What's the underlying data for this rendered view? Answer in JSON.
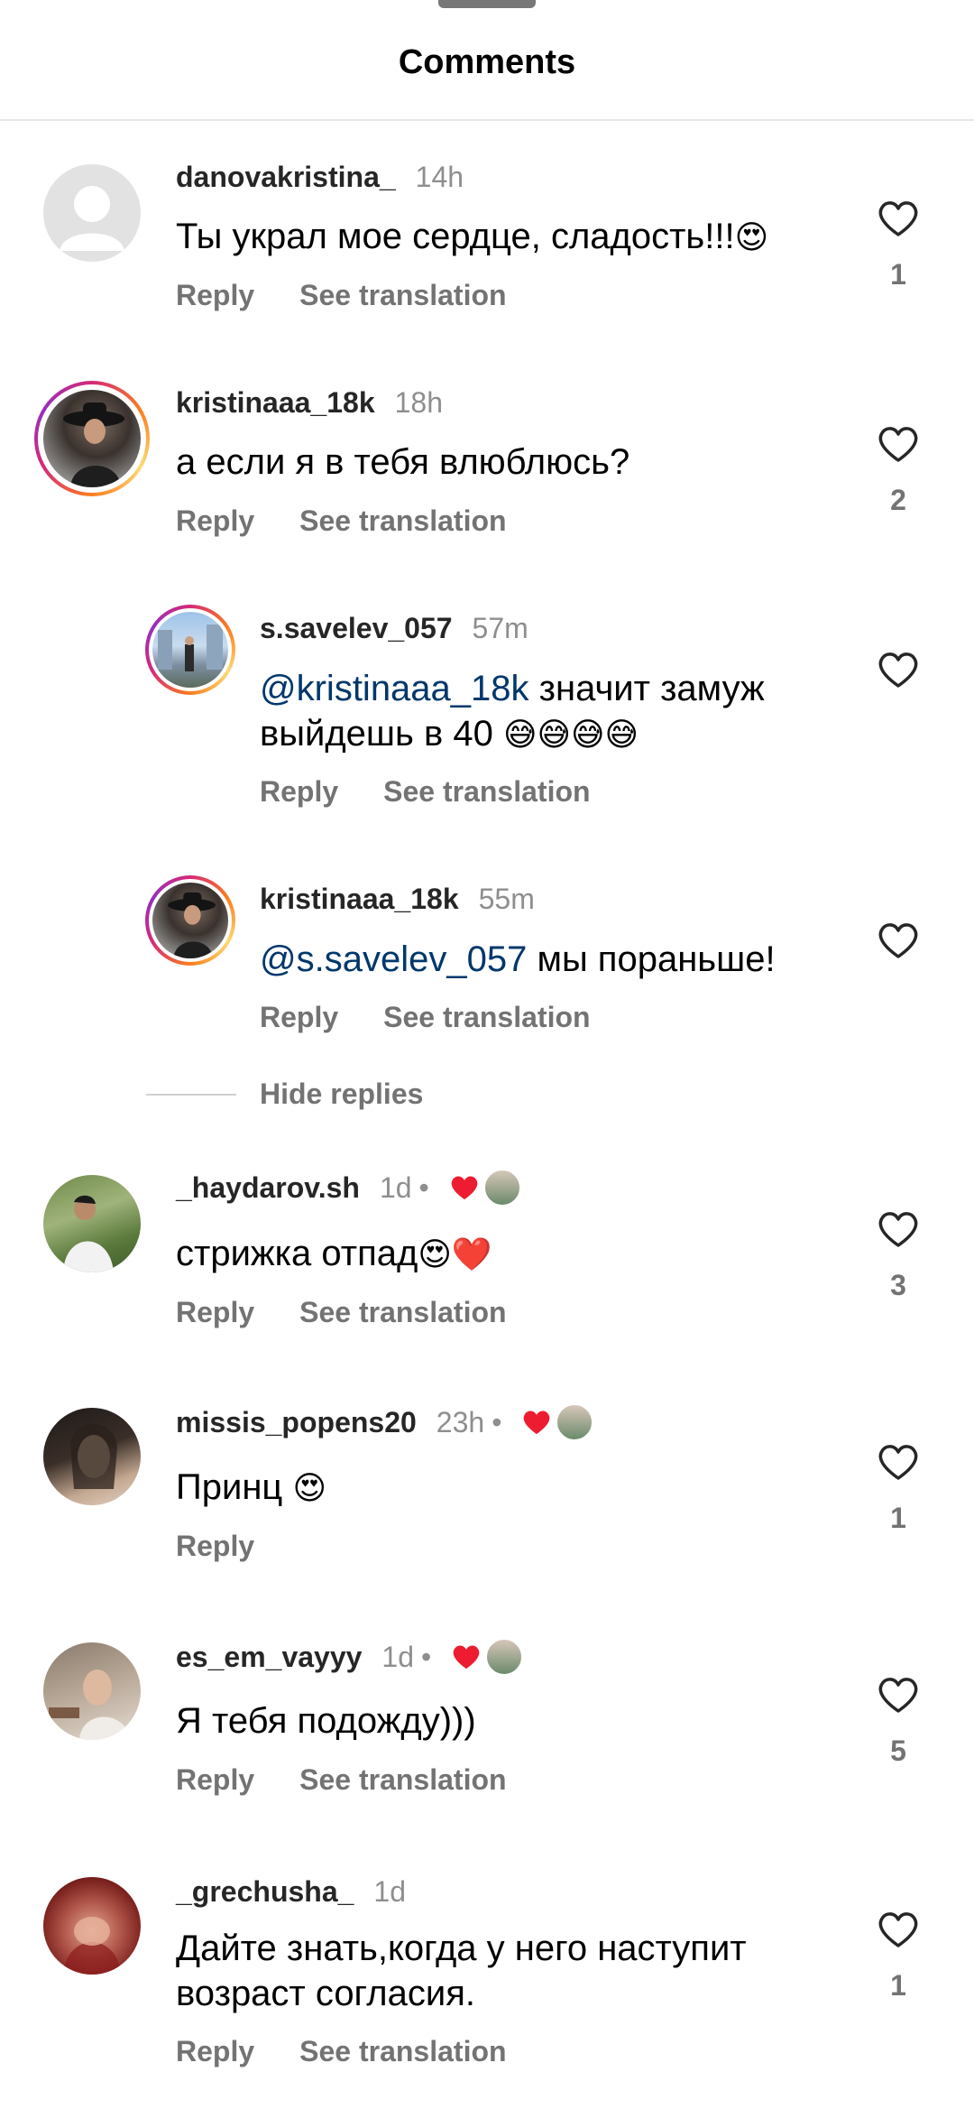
{
  "header": {
    "title": "Comments"
  },
  "labels": {
    "reply": "Reply",
    "see_translation": "See translation",
    "hide_replies": "Hide replies"
  },
  "comments": [
    {
      "username": "danovakristina_",
      "time": "14h",
      "text": "Ты украл мое сердце, сладость!!!",
      "emoji": "😍",
      "likes": "1"
    },
    {
      "username": "kristinaaa_18k",
      "time": "18h",
      "text": "а если я в тебя влюблюсь?",
      "likes": "2"
    },
    {
      "username": "s.savelev_057",
      "time": "57m",
      "mention": "@kristinaaa_18k",
      "text": " значит замуж",
      "text2": "выйдешь в 40 ",
      "emoji": "😅😅😅😅"
    },
    {
      "username": "kristinaaa_18k",
      "time": "55m",
      "mention": "@s.savelev_057",
      "text": " мы пораньше!"
    },
    {
      "username": "_haydarov.sh",
      "time": "1d",
      "text": "стрижка отпад",
      "emoji": "😍❤️",
      "likes": "3"
    },
    {
      "username": "missis_popens20",
      "time": "23h",
      "text": "Принц ",
      "emoji": "😍",
      "likes": "1"
    },
    {
      "username": "es_em_vayyy",
      "time": "1d",
      "text": "Я тебя подожду)))",
      "likes": "5"
    },
    {
      "username": "_grechusha_",
      "time": "1d",
      "text": "Дайте знать,когда у него наступит",
      "text2": "возраст согласия.",
      "likes": "1"
    }
  ],
  "icons": {
    "heart": "heart-outline-icon",
    "creator_heart": "heart-filled-icon"
  },
  "colors": {
    "mention": "#00376b",
    "muted": "#737373",
    "heart_red": "#ed1c30"
  }
}
